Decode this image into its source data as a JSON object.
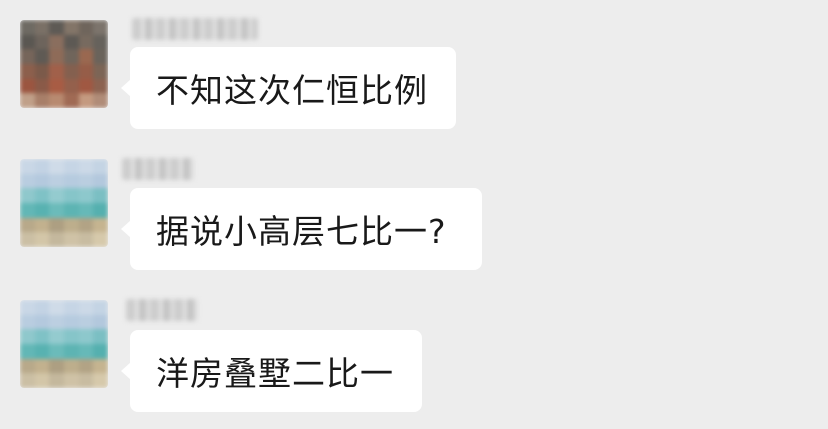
{
  "messages": [
    {
      "sender": "",
      "avatar": "pixelated-avatar-dark",
      "text": "不知这次仁恒比例"
    },
    {
      "sender": "",
      "avatar": "pixelated-avatar-beach",
      "text": "据说小高层七比一?"
    },
    {
      "sender": "",
      "avatar": "pixelated-avatar-beach",
      "text": "洋房叠墅二比一"
    }
  ],
  "colors": {
    "background": "#ededed",
    "bubble": "#ffffff",
    "text": "#191919"
  }
}
